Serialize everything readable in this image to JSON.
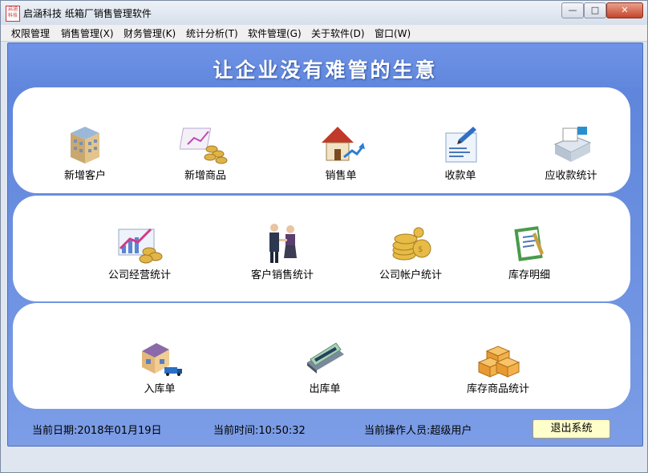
{
  "window": {
    "title": "启涵科技 纸箱厂销售管理软件",
    "app_icon_text": "启涵科技",
    "controls": {
      "minimize": "—",
      "maximize": "□",
      "close": "✕"
    }
  },
  "menu": [
    "权限管理",
    "销售管理(X)",
    "财务管理(K)",
    "统计分析(T)",
    "软件管理(G)",
    "关于软件(D)",
    "窗口(W)"
  ],
  "banner": "让企业没有难管的生意",
  "rows": [
    [
      {
        "label": "新增客户",
        "icon": "building-icon"
      },
      {
        "label": "新增商品",
        "icon": "coins-chart-icon"
      },
      {
        "label": "销售单",
        "icon": "house-icon"
      },
      {
        "label": "收款单",
        "icon": "receipt-icon"
      },
      {
        "label": "应收款统计",
        "icon": "printer-icon"
      }
    ],
    [
      {
        "label": "公司经营统计",
        "icon": "growth-chart-icon"
      },
      {
        "label": "客户销售统计",
        "icon": "handshake-icon"
      },
      {
        "label": "公司帐户统计",
        "icon": "gold-coins-icon"
      },
      {
        "label": "库存明细",
        "icon": "clipboard-icon"
      }
    ],
    [
      {
        "label": "入库单",
        "icon": "warehouse-truck-icon"
      },
      {
        "label": "出库单",
        "icon": "card-icon"
      },
      {
        "label": "库存商品统计",
        "icon": "boxes-icon"
      }
    ]
  ],
  "status": {
    "date": "当前日期:2018年01月19日",
    "time": "当前时间:10:50:32",
    "operator": "当前操作人员:超级用户",
    "exit": "退出系统"
  }
}
